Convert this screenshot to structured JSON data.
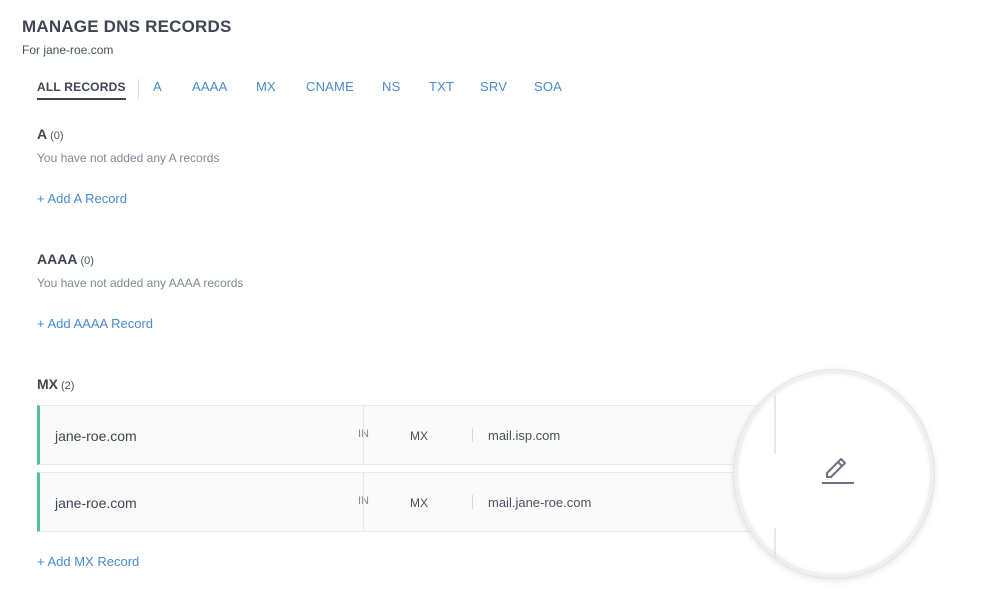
{
  "header": {
    "title": "MANAGE DNS RECORDS",
    "subtitle": "For jane-roe.com"
  },
  "tabs": [
    {
      "label": "ALL RECORDS",
      "active": true
    },
    {
      "label": "A"
    },
    {
      "label": "AAAA"
    },
    {
      "label": "MX"
    },
    {
      "label": "CNAME"
    },
    {
      "label": "NS"
    },
    {
      "label": "TXT"
    },
    {
      "label": "SRV"
    },
    {
      "label": "SOA"
    }
  ],
  "sections": {
    "a": {
      "title": "A",
      "count": "(0)",
      "empty_text": "You have not added any A records",
      "add_label": "+ Add A Record"
    },
    "aaaa": {
      "title": "AAAA",
      "count": "(0)",
      "empty_text": "You have not added any AAAA records",
      "add_label": "+ Add AAAA Record"
    },
    "mx": {
      "title": "MX",
      "count": "(2)",
      "records": [
        {
          "host": "jane-roe.com",
          "class": "IN",
          "type": "MX",
          "value": "mail.isp.com"
        },
        {
          "host": "jane-roe.com",
          "class": "IN",
          "type": "MX",
          "value": "mail.jane-roe.com"
        }
      ],
      "add_label": "+ Add MX Record"
    }
  },
  "icons": {
    "edit": "pencil-icon"
  },
  "colors": {
    "accent": "#4a8ad0",
    "record_border": "#4fc09a",
    "heading": "#3e4652"
  }
}
